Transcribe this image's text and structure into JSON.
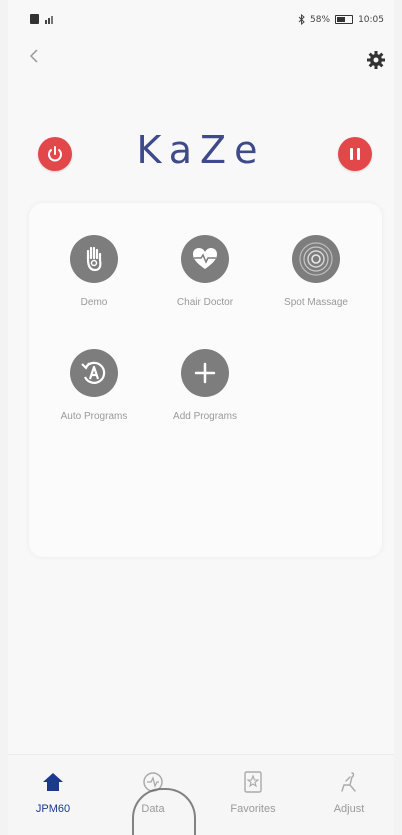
{
  "status_bar": {
    "left_icons": [
      "sim-icon",
      "signal-icon"
    ],
    "bluetooth_icon": "bluetooth-icon",
    "battery_text": "58%",
    "time": "10:05"
  },
  "header": {
    "back_icon": "chevron-left-icon",
    "settings_icon": "gear-icon",
    "brand": "KaZe",
    "power_icon": "power-icon",
    "pause_icon": "pause-icon"
  },
  "programs": [
    {
      "label": "Demo",
      "icon": "hand-icon"
    },
    {
      "label": "Chair Doctor",
      "icon": "heart-pulse-icon"
    },
    {
      "label": "Spot Massage",
      "icon": "target-icon"
    },
    {
      "label": "Auto Programs",
      "icon": "auto-cycle-icon"
    },
    {
      "label": "Add Programs",
      "icon": "plus-icon"
    }
  ],
  "bottom_nav": [
    {
      "label": "JPM60",
      "icon": "home-icon",
      "active": true
    },
    {
      "label": "Data",
      "icon": "data-icon",
      "active": false
    },
    {
      "label": "Favorites",
      "icon": "favorites-icon",
      "active": false
    },
    {
      "label": "Adjust",
      "icon": "adjust-icon",
      "active": false
    }
  ],
  "colors": {
    "accent_red": "#e2474a",
    "brand_blue": "#3e4a8a",
    "icon_gray": "#7d7d7d",
    "active_nav": "#1b3a8c"
  }
}
